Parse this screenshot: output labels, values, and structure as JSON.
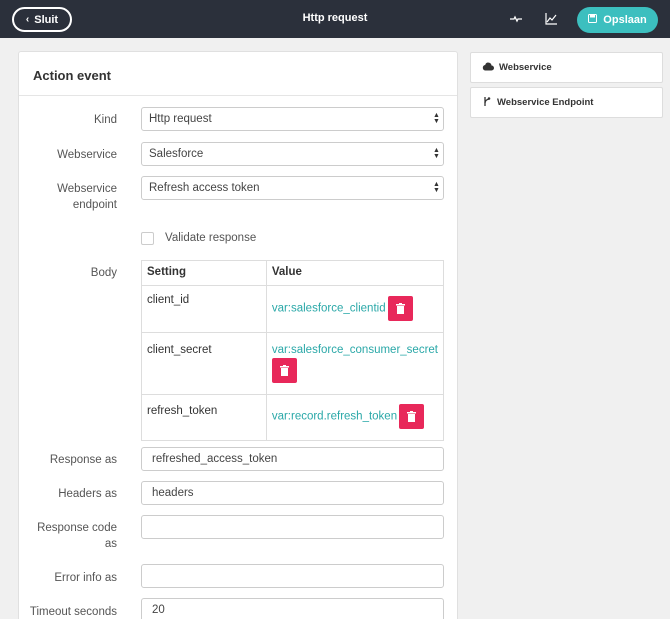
{
  "topbar": {
    "close_label": "Sluit",
    "title": "Http request",
    "save_label": "Opslaan"
  },
  "panel": {
    "title": "Action event",
    "kind_label": "Kind",
    "kind_value": "Http request",
    "webservice_label": "Webservice",
    "webservice_value": "Salesforce",
    "endpoint_label_1": "Webservice",
    "endpoint_label_2": "endpoint",
    "endpoint_value": "Refresh access token",
    "validate_label": "Validate response",
    "validate_checked": false,
    "body_label": "Body",
    "body_table": {
      "headers": [
        "Setting",
        "Value"
      ],
      "rows": [
        {
          "setting": "client_id",
          "value": "var:salesforce_clientid"
        },
        {
          "setting": "client_secret",
          "value": "var:salesforce_consumer_secret"
        },
        {
          "setting": "refresh_token",
          "value": "var:record.refresh_token"
        }
      ]
    },
    "response_as_label": "Response as",
    "response_as_value": "refreshed_access_token",
    "headers_as_label": "Headers as",
    "headers_as_value": "headers",
    "response_code_label_1": "Response code",
    "response_code_label_2": "as",
    "response_code_value": "",
    "error_info_label": "Error info as",
    "error_info_value": "",
    "timeout_label": "Timeout seconds",
    "timeout_value": "20"
  },
  "sidebar": {
    "items": [
      {
        "label": "Webservice",
        "icon": "cloud-icon"
      },
      {
        "label": "Webservice Endpoint",
        "icon": "branch-icon"
      }
    ]
  },
  "colors": {
    "topbar_bg": "#2b303b",
    "accent": "#3cbfbf",
    "delete": "#e8285a",
    "link": "#2aa8a8"
  }
}
